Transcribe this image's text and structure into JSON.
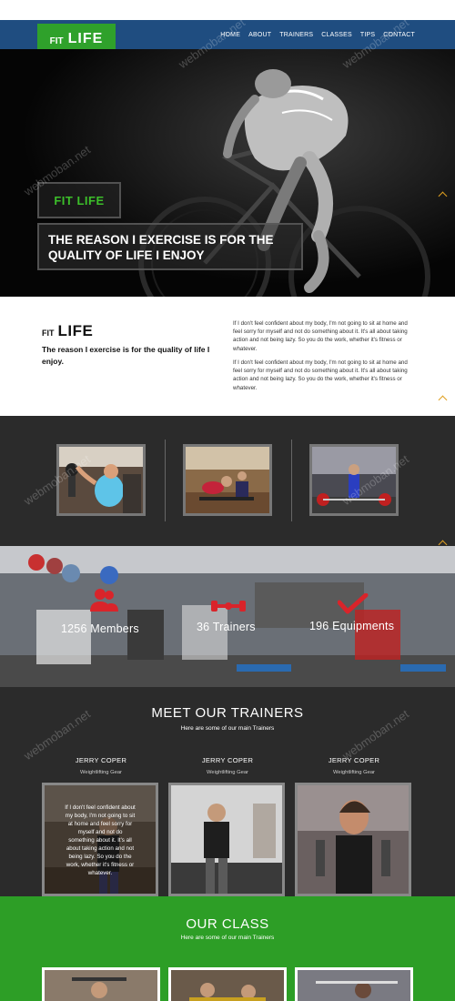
{
  "brand": {
    "prefix": "FIT",
    "name": "LIFE"
  },
  "nav": [
    "HOME",
    "ABOUT",
    "TRAINERS",
    "CLASSES",
    "TIPS",
    "CONTACT"
  ],
  "hero": {
    "tag": "FIT LIFE",
    "title_line1": "THE REASON I EXERCISE IS FOR THE",
    "title_line2": "QUALITY OF LIFE I ENJOY"
  },
  "intro": {
    "logo_prefix": "FIT",
    "logo_name": "LIFE",
    "tagline": "The reason I exercise is for the quality of life I enjoy.",
    "para1": "If I don't feel confident about my body, I'm not going to sit at home and feel sorry for myself and not do something about it. It's all about taking action and not being lazy. So you do the work, whether it's fitness or whatever.",
    "para2": "If I don't feel confident about my body, I'm not going to sit at home and feel sorry for myself and not do something about it. It's all about taking action and not being lazy. So you do the work, whether it's fitness or whatever."
  },
  "stats": {
    "members": "1256 Members",
    "trainers": "36 Trainers",
    "equipments": "196 Equipments"
  },
  "trainers_section": {
    "title": "MEET OUR TRAINERS",
    "subtitle": "Here are some of our main Trainers",
    "cards": [
      {
        "name": "JERRY COPER",
        "role": "Weightlifting Gear",
        "overlay": "If I don't feel confident about my body, I'm not going to sit at home and feel sorry for myself and not do something about it. It's all about taking action and not being lazy. So you do the work, whether it's fitness or whatever."
      },
      {
        "name": "JERRY COPER",
        "role": "Weightlifting Gear"
      },
      {
        "name": "JERRY COPER",
        "role": "Weightlifting Gear"
      }
    ]
  },
  "class_section": {
    "title": "OUR CLASS",
    "subtitle": "Here are some of our main Trainers"
  },
  "watermark": "webmoban.net",
  "colors": {
    "nav": "#1f4d80",
    "accent_green": "#2fa12b",
    "dark": "#2b2b2b",
    "chevron": "#e0a020",
    "icon_red": "#d9242a"
  },
  "icons": [
    "members-icon",
    "trainers-icon",
    "equipments-icon",
    "chevron-up-icon"
  ]
}
